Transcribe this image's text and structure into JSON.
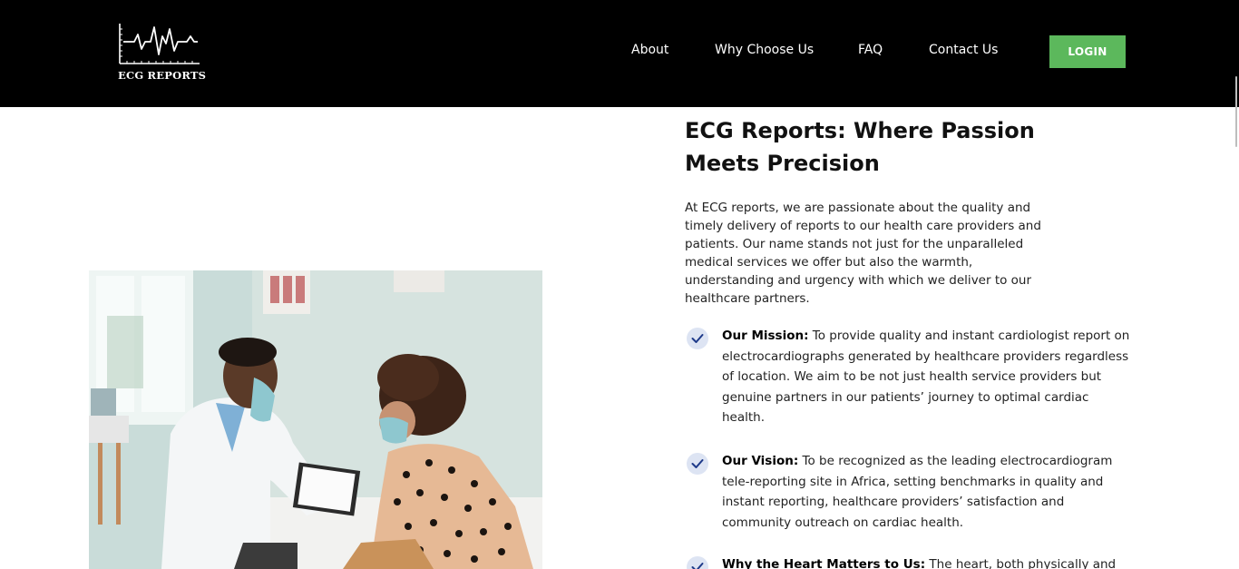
{
  "header": {
    "logo_text": "ECG REPORTS",
    "nav": [
      "About",
      "Why Choose Us",
      "FAQ",
      "Contact Us"
    ],
    "login_label": "LOGIN"
  },
  "colors": {
    "header_bg": "#000000",
    "login_button": "#5cb85c",
    "check_badge": "#dde4f3",
    "check_mark": "#1e3a8a"
  },
  "main": {
    "headline": "ECG Reports: Where Passion Meets Precision",
    "intro": "At ECG reports, we are passionate about the quality and timely delivery of reports to our health care providers and patients. Our name stands not just for the unparalleled medical services we offer but also the warmth, understanding and urgency with which we deliver to our healthcare partners.",
    "points": [
      {
        "title": "Our Mission:",
        "text": " To provide quality and instant cardiologist report on electrocardiographs generated by healthcare providers regardless of location. We aim to be not just health service providers but genuine partners in our patients’ journey to optimal cardiac health.",
        "icon": "check-icon"
      },
      {
        "title": "Our Vision:",
        "text": " To be recognized as the leading electrocardiogram tele-reporting site in Africa, setting benchmarks in quality and instant reporting, healthcare providers’ satisfaction and community outreach on cardiac health.",
        "icon": "check-icon"
      },
      {
        "title": "Why the Heart Matters to Us:",
        "text": " The heart, both physically and",
        "icon": "check-icon"
      }
    ]
  }
}
